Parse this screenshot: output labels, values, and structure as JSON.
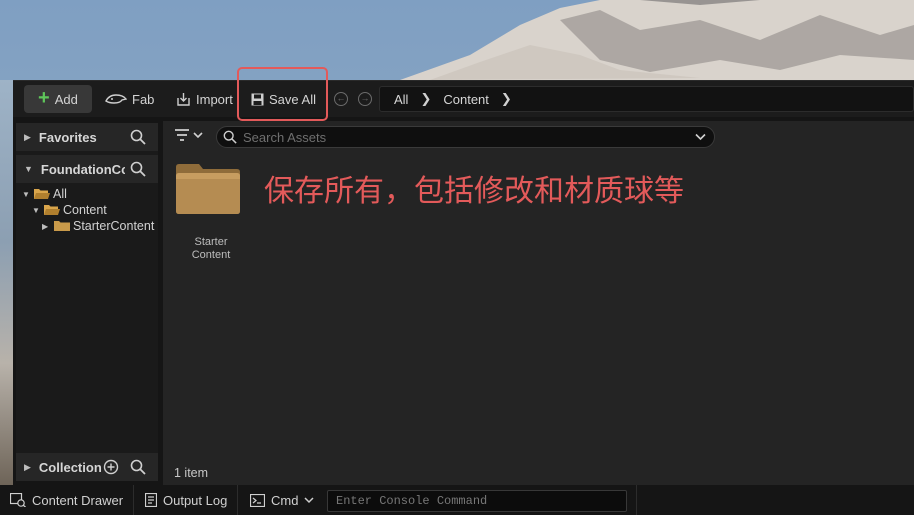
{
  "toolbar": {
    "add_label": "Add",
    "fab_label": "Fab",
    "import_label": "Import",
    "save_all_label": "Save All"
  },
  "breadcrumb": {
    "items": [
      "All",
      "Content"
    ]
  },
  "sidebar": {
    "favorites_label": "Favorites",
    "project_label": "FoundationCou",
    "tree": [
      {
        "label": "All"
      },
      {
        "label": "Content"
      },
      {
        "label": "StarterContent"
      }
    ],
    "collection_label": "Collection"
  },
  "main": {
    "search_placeholder": "Search Assets",
    "folders": [
      {
        "label": "Starter\nContent"
      }
    ],
    "item_count": "1 item"
  },
  "annotation": "保存所有，包括修改和材质球等",
  "statusbar": {
    "content_drawer_label": "Content Drawer",
    "output_log_label": "Output Log",
    "cmd_label": "Cmd",
    "console_placeholder": "Enter Console Command"
  },
  "colors": {
    "accent_green": "#5ec55a",
    "highlight_red": "#e35a5a",
    "folder_tan": "#b08a50"
  }
}
